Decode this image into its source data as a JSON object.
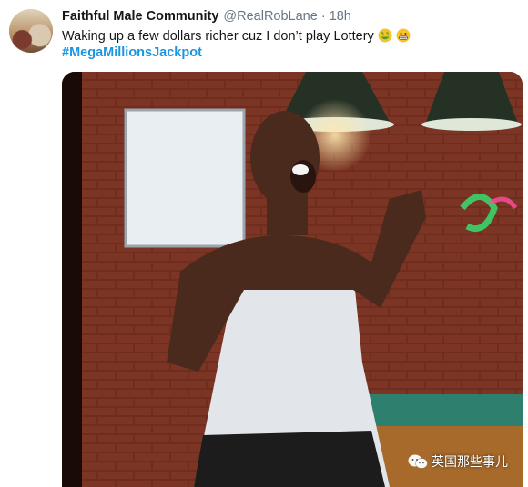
{
  "tweet": {
    "display_name": "Faithful Male Community",
    "handle": "@RealRobLane",
    "separator": "·",
    "time": "18h",
    "text": "Waking up a few dollars richer cuz I don’t play Lottery",
    "emojis": [
      "money-mouth-face-emoji",
      "grimacing-face-emoji"
    ],
    "hashtag": "#MegaMillionsJackpot"
  },
  "media": {
    "watermark_text": "英国那些事儿"
  },
  "colors": {
    "link": "#1b95e0",
    "name": "#14171a",
    "muted": "#657786"
  }
}
